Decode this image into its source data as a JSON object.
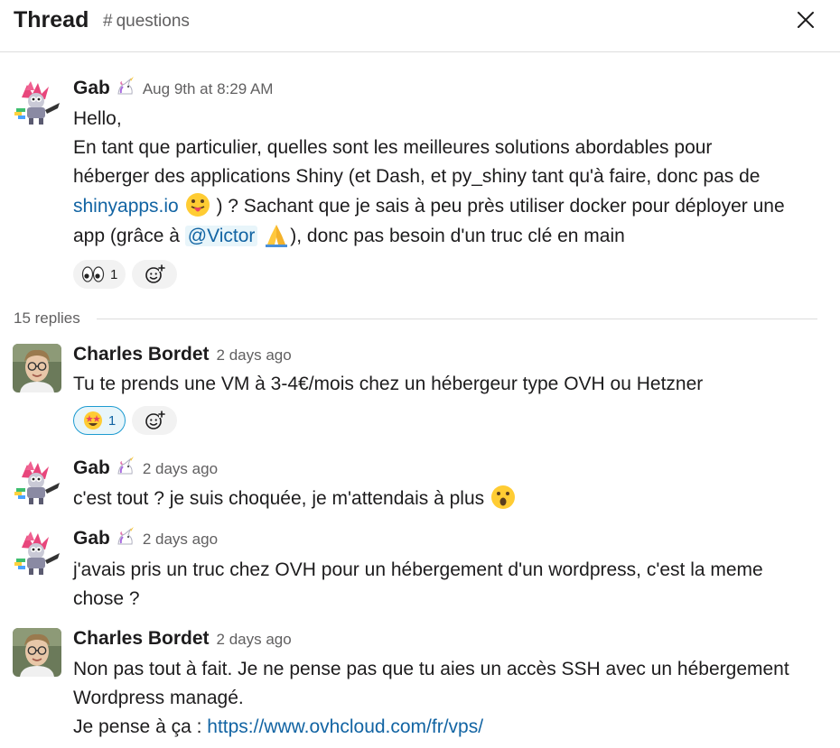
{
  "header": {
    "title": "Thread",
    "channel": "questions",
    "close_icon": "close-icon"
  },
  "thread": {
    "replies_label": "15 replies"
  },
  "messages": [
    {
      "author": "Gab",
      "author_icon": "unicorn-icon",
      "timestamp": "Aug 9th at 8:29 AM",
      "avatar_icon": "unicorn-avatar",
      "lines": {
        "l1": "Hello,",
        "l2": "En tant que particulier, quelles sont les meilleures solutions abordables pour",
        "l3": "héberger des applications Shiny (et Dash, et py_shiny tant qu'à faire, donc pas de",
        "l4_link": "shinyapps.io",
        "l4_icon": "tongue-out-emoji",
        "l4_rest": ") ? Sachant que je sais à peu près utiliser docker pour déployer une",
        "l5_start": "app (grâce à",
        "mention": "@Victor",
        "l5_icon": "folded-hands-emoji",
        "l5_end": "), donc pas besoin d'un truc clé en main"
      },
      "reactions": [
        {
          "icon": "eyes-emoji",
          "count": "1"
        }
      ]
    },
    {
      "author": "Charles Bordet",
      "timestamp": "2 days ago",
      "avatar_icon": "person-avatar",
      "text": "Tu te prends une VM à 3-4€/mois chez un hébergeur type OVH ou Hetzner",
      "reactions": [
        {
          "icon": "star-struck-emoji",
          "count": "1"
        }
      ]
    },
    {
      "author": "Gab",
      "author_icon": "unicorn-icon",
      "timestamp": "2 days ago",
      "avatar_icon": "unicorn-avatar",
      "text": "c'est tout ? je suis choquée, je m'attendais à plus",
      "text_icon": "surprised-emoji"
    },
    {
      "author": "Gab",
      "author_icon": "unicorn-icon",
      "timestamp": "2 days ago",
      "avatar_icon": "unicorn-avatar",
      "l1": "j'avais pris un truc chez OVH pour un hébergement d'un wordpress, c'est la meme",
      "l2": "chose ?"
    },
    {
      "author": "Charles Bordet",
      "timestamp": "2 days ago",
      "avatar_icon": "person-avatar",
      "l1": "Non pas tout à fait. Je ne pense pas que tu aies un accès SSH avec un hébergement",
      "l2": "Wordpress managé.",
      "l3_start": "Je pense à ça :",
      "l3_link": "https://www.ovhcloud.com/fr/vps/"
    }
  ],
  "colors": {
    "link": "#1264a3",
    "mention_bg": "#e8f5fa",
    "muted": "#616061",
    "divider": "#dddddd"
  }
}
